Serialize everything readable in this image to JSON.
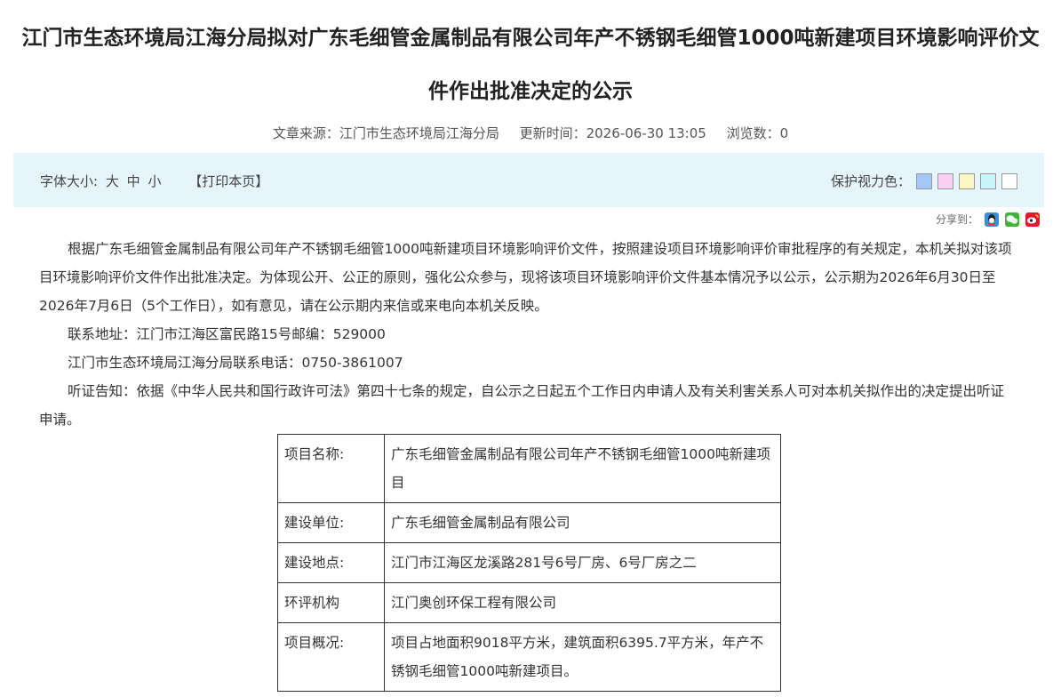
{
  "title": "江门市生态环境局江海分局拟对广东毛细管金属制品有限公司年产不锈钢毛细管1000吨新建项目环境影响评价文件作出批准决定的公示",
  "meta": {
    "source": "文章来源：江门市生态环境局江海分局",
    "updated": "更新时间：2026-06-30 13:05",
    "views": "浏览数：0"
  },
  "toolbar": {
    "font_label": "字体大小:",
    "font_large": "大",
    "font_medium": "中",
    "font_small": "小",
    "print": "【打印本页】",
    "eye_label": "保护视力色：",
    "swatches": [
      "#a4c8f5",
      "#f7d0f3",
      "#fdf7c4",
      "#c8f5f5",
      "#ffffff"
    ]
  },
  "share": {
    "label": "分享到：",
    "icons": [
      "qq-icon",
      "wechat-icon",
      "weibo-icon"
    ]
  },
  "body": {
    "p1": "根据广东毛细管金属制品有限公司年产不锈钢毛细管1000吨新建项目环境影响评价文件，按照建设项目环境影响评价审批程序的有关规定，本机关拟对该项目环境影响评价文件作出批准决定。为体现公开、公正的原则，强化公众参与，现将该项目环境影响评价文件基本情况予以公示，公示期为2026年6月30日至2026年7月6日（5个工作日），如有意见，请在公示期内来信或来电向本机关反映。",
    "p2": "联系地址：江门市江海区富民路15号邮编：529000",
    "p3": "江门市生态环境局江海分局联系电话：0750-3861007",
    "p4": "听证告知：依据《中华人民共和国行政许可法》第四十七条的规定，自公示之日起五个工作日内申请人及有关利害关系人可对本机关拟作出的决定提出听证申请。"
  },
  "table": {
    "rows": [
      {
        "key": "项目名称:",
        "value": "广东毛细管金属制品有限公司年产不锈钢毛细管1000吨新建项目"
      },
      {
        "key": "建设单位:",
        "value": "广东毛细管金属制品有限公司"
      },
      {
        "key": "建设地点:",
        "value": "江门市江海区龙溪路281号6号厂房、6号厂房之二"
      },
      {
        "key": "环评机构",
        "value": "江门奥创环保工程有限公司"
      },
      {
        "key": "项目概况:",
        "value": "项目占地面积9018平方米，建筑面积6395.7平方米，年产不锈钢毛细管1000吨新建项目。"
      }
    ]
  }
}
